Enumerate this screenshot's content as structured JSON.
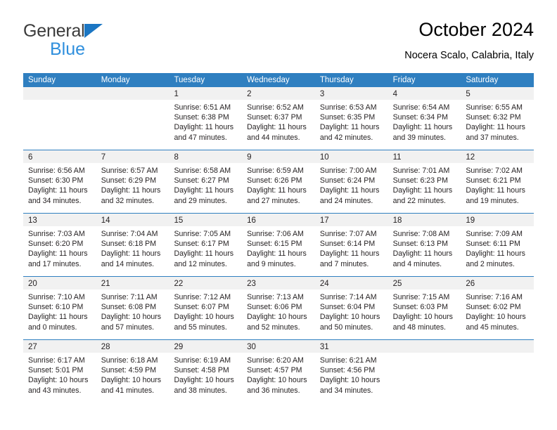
{
  "brand": {
    "line1": "General",
    "line2": "Blue",
    "triangle_color": "#1b76c3",
    "text_color": "#3b3b3b",
    "blue_text_color": "#2f8fdd"
  },
  "header": {
    "title": "October 2024",
    "subtitle": "Nocera Scalo, Calabria, Italy"
  },
  "theme": {
    "header_bg": "#2f7fc0",
    "header_text": "#ffffff",
    "daynum_band_bg": "#f1f1f1",
    "cell_bg": "#ffffff",
    "text": "#231f20"
  },
  "calendar": {
    "weekday_headers": [
      "Sunday",
      "Monday",
      "Tuesday",
      "Wednesday",
      "Thursday",
      "Friday",
      "Saturday"
    ],
    "weeks": [
      [
        {
          "day": "",
          "lines": []
        },
        {
          "day": "",
          "lines": []
        },
        {
          "day": "1",
          "lines": [
            "Sunrise: 6:51 AM",
            "Sunset: 6:38 PM",
            "Daylight: 11 hours",
            "and 47 minutes."
          ]
        },
        {
          "day": "2",
          "lines": [
            "Sunrise: 6:52 AM",
            "Sunset: 6:37 PM",
            "Daylight: 11 hours",
            "and 44 minutes."
          ]
        },
        {
          "day": "3",
          "lines": [
            "Sunrise: 6:53 AM",
            "Sunset: 6:35 PM",
            "Daylight: 11 hours",
            "and 42 minutes."
          ]
        },
        {
          "day": "4",
          "lines": [
            "Sunrise: 6:54 AM",
            "Sunset: 6:34 PM",
            "Daylight: 11 hours",
            "and 39 minutes."
          ]
        },
        {
          "day": "5",
          "lines": [
            "Sunrise: 6:55 AM",
            "Sunset: 6:32 PM",
            "Daylight: 11 hours",
            "and 37 minutes."
          ]
        }
      ],
      [
        {
          "day": "6",
          "lines": [
            "Sunrise: 6:56 AM",
            "Sunset: 6:30 PM",
            "Daylight: 11 hours",
            "and 34 minutes."
          ]
        },
        {
          "day": "7",
          "lines": [
            "Sunrise: 6:57 AM",
            "Sunset: 6:29 PM",
            "Daylight: 11 hours",
            "and 32 minutes."
          ]
        },
        {
          "day": "8",
          "lines": [
            "Sunrise: 6:58 AM",
            "Sunset: 6:27 PM",
            "Daylight: 11 hours",
            "and 29 minutes."
          ]
        },
        {
          "day": "9",
          "lines": [
            "Sunrise: 6:59 AM",
            "Sunset: 6:26 PM",
            "Daylight: 11 hours",
            "and 27 minutes."
          ]
        },
        {
          "day": "10",
          "lines": [
            "Sunrise: 7:00 AM",
            "Sunset: 6:24 PM",
            "Daylight: 11 hours",
            "and 24 minutes."
          ]
        },
        {
          "day": "11",
          "lines": [
            "Sunrise: 7:01 AM",
            "Sunset: 6:23 PM",
            "Daylight: 11 hours",
            "and 22 minutes."
          ]
        },
        {
          "day": "12",
          "lines": [
            "Sunrise: 7:02 AM",
            "Sunset: 6:21 PM",
            "Daylight: 11 hours",
            "and 19 minutes."
          ]
        }
      ],
      [
        {
          "day": "13",
          "lines": [
            "Sunrise: 7:03 AM",
            "Sunset: 6:20 PM",
            "Daylight: 11 hours",
            "and 17 minutes."
          ]
        },
        {
          "day": "14",
          "lines": [
            "Sunrise: 7:04 AM",
            "Sunset: 6:18 PM",
            "Daylight: 11 hours",
            "and 14 minutes."
          ]
        },
        {
          "day": "15",
          "lines": [
            "Sunrise: 7:05 AM",
            "Sunset: 6:17 PM",
            "Daylight: 11 hours",
            "and 12 minutes."
          ]
        },
        {
          "day": "16",
          "lines": [
            "Sunrise: 7:06 AM",
            "Sunset: 6:15 PM",
            "Daylight: 11 hours",
            "and 9 minutes."
          ]
        },
        {
          "day": "17",
          "lines": [
            "Sunrise: 7:07 AM",
            "Sunset: 6:14 PM",
            "Daylight: 11 hours",
            "and 7 minutes."
          ]
        },
        {
          "day": "18",
          "lines": [
            "Sunrise: 7:08 AM",
            "Sunset: 6:13 PM",
            "Daylight: 11 hours",
            "and 4 minutes."
          ]
        },
        {
          "day": "19",
          "lines": [
            "Sunrise: 7:09 AM",
            "Sunset: 6:11 PM",
            "Daylight: 11 hours",
            "and 2 minutes."
          ]
        }
      ],
      [
        {
          "day": "20",
          "lines": [
            "Sunrise: 7:10 AM",
            "Sunset: 6:10 PM",
            "Daylight: 11 hours",
            "and 0 minutes."
          ]
        },
        {
          "day": "21",
          "lines": [
            "Sunrise: 7:11 AM",
            "Sunset: 6:08 PM",
            "Daylight: 10 hours",
            "and 57 minutes."
          ]
        },
        {
          "day": "22",
          "lines": [
            "Sunrise: 7:12 AM",
            "Sunset: 6:07 PM",
            "Daylight: 10 hours",
            "and 55 minutes."
          ]
        },
        {
          "day": "23",
          "lines": [
            "Sunrise: 7:13 AM",
            "Sunset: 6:06 PM",
            "Daylight: 10 hours",
            "and 52 minutes."
          ]
        },
        {
          "day": "24",
          "lines": [
            "Sunrise: 7:14 AM",
            "Sunset: 6:04 PM",
            "Daylight: 10 hours",
            "and 50 minutes."
          ]
        },
        {
          "day": "25",
          "lines": [
            "Sunrise: 7:15 AM",
            "Sunset: 6:03 PM",
            "Daylight: 10 hours",
            "and 48 minutes."
          ]
        },
        {
          "day": "26",
          "lines": [
            "Sunrise: 7:16 AM",
            "Sunset: 6:02 PM",
            "Daylight: 10 hours",
            "and 45 minutes."
          ]
        }
      ],
      [
        {
          "day": "27",
          "lines": [
            "Sunrise: 6:17 AM",
            "Sunset: 5:01 PM",
            "Daylight: 10 hours",
            "and 43 minutes."
          ]
        },
        {
          "day": "28",
          "lines": [
            "Sunrise: 6:18 AM",
            "Sunset: 4:59 PM",
            "Daylight: 10 hours",
            "and 41 minutes."
          ]
        },
        {
          "day": "29",
          "lines": [
            "Sunrise: 6:19 AM",
            "Sunset: 4:58 PM",
            "Daylight: 10 hours",
            "and 38 minutes."
          ]
        },
        {
          "day": "30",
          "lines": [
            "Sunrise: 6:20 AM",
            "Sunset: 4:57 PM",
            "Daylight: 10 hours",
            "and 36 minutes."
          ]
        },
        {
          "day": "31",
          "lines": [
            "Sunrise: 6:21 AM",
            "Sunset: 4:56 PM",
            "Daylight: 10 hours",
            "and 34 minutes."
          ]
        },
        {
          "day": "",
          "lines": []
        },
        {
          "day": "",
          "lines": []
        }
      ]
    ]
  }
}
